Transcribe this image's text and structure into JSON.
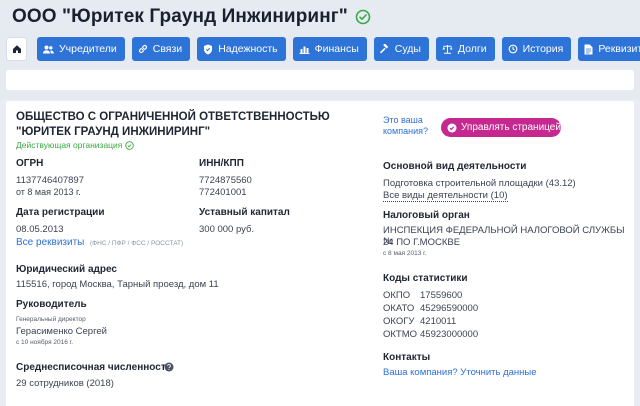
{
  "company": {
    "title": "ООО \"Юритек Граунд Инжиниринг\"",
    "full_name": "ОБЩЕСТВО С ОГРАНИЧЕННОЙ ОТВЕТСТВЕННОСТЬЮ \"ЮРИТЕК ГРАУНД ИНЖИНИРИНГ\"",
    "status": "Действующая организация"
  },
  "nav": {
    "items": [
      {
        "label": "Учредители",
        "icon": "users-icon"
      },
      {
        "label": "Связи",
        "icon": "link-icon"
      },
      {
        "label": "Надежность",
        "icon": "shield-icon"
      },
      {
        "label": "Финансы",
        "icon": "chart-icon"
      },
      {
        "label": "Суды",
        "icon": "gavel-icon"
      },
      {
        "label": "Долги",
        "icon": "scales-icon"
      },
      {
        "label": "История",
        "icon": "history-icon"
      },
      {
        "label": "Реквизиты",
        "icon": "document-icon"
      }
    ]
  },
  "owner": {
    "question": "Это ваша компания?",
    "question_line1": "Это ваша",
    "question_line2": "компания?",
    "manage_label": "Управлять страницей"
  },
  "details": {
    "ogrn_label": "ОГРН",
    "ogrn_value": "1137746407897",
    "ogrn_date": "от 8 мая 2013 г.",
    "inn_label": "ИНН/КПП",
    "inn_value": "7724875560",
    "kpp_value": "772401001",
    "reg_label": "Дата регистрации",
    "reg_value": "08.05.2013",
    "all_requisites": "Все реквизиты",
    "funds_note": "(ФНС / ПФР / ФСС / РОССТАТ)",
    "capital_label": "Уставный капитал",
    "capital_value": "300 000 руб.",
    "address_label": "Юридический адрес",
    "address_value": "115516, город Москва, Тарный проезд, дом 11",
    "head_label": "Руководитель",
    "head_position": "Генеральный директор",
    "head_name": "Герасименко Сергей",
    "head_since": "с 10 ноября 2016 г.",
    "employees_label": "Среднесписочная численность",
    "employees_value": "29 сотрудников (2018)"
  },
  "activity": {
    "label": "Основной вид деятельности",
    "value": "Подготовка строительной площадки",
    "code": "(43.12)",
    "all_label": "Все виды деятельности (10)"
  },
  "tax": {
    "label": "Налоговый орган",
    "value_line1": "ИНСПЕКЦИЯ ФЕДЕРАЛЬНОЙ НАЛОГОВОЙ СЛУЖБЫ №",
    "value_line2": "24 ПО Г.МОСКВЕ",
    "since": "с 8 мая 2013 г."
  },
  "stats": {
    "label": "Коды статистики",
    "rows": [
      {
        "k": "ОКПО",
        "v": "17559600"
      },
      {
        "k": "ОКАТО",
        "v": "45296590000"
      },
      {
        "k": "ОКОГУ",
        "v": "4210011"
      },
      {
        "k": "ОКТМО",
        "v": "45923000000"
      }
    ]
  },
  "contacts": {
    "label": "Контакты",
    "link": "Ваша компания? Уточнить данные"
  },
  "colors": {
    "accent": "#2e73d8",
    "manage": "#c5288f",
    "status_green": "#3aa845"
  }
}
